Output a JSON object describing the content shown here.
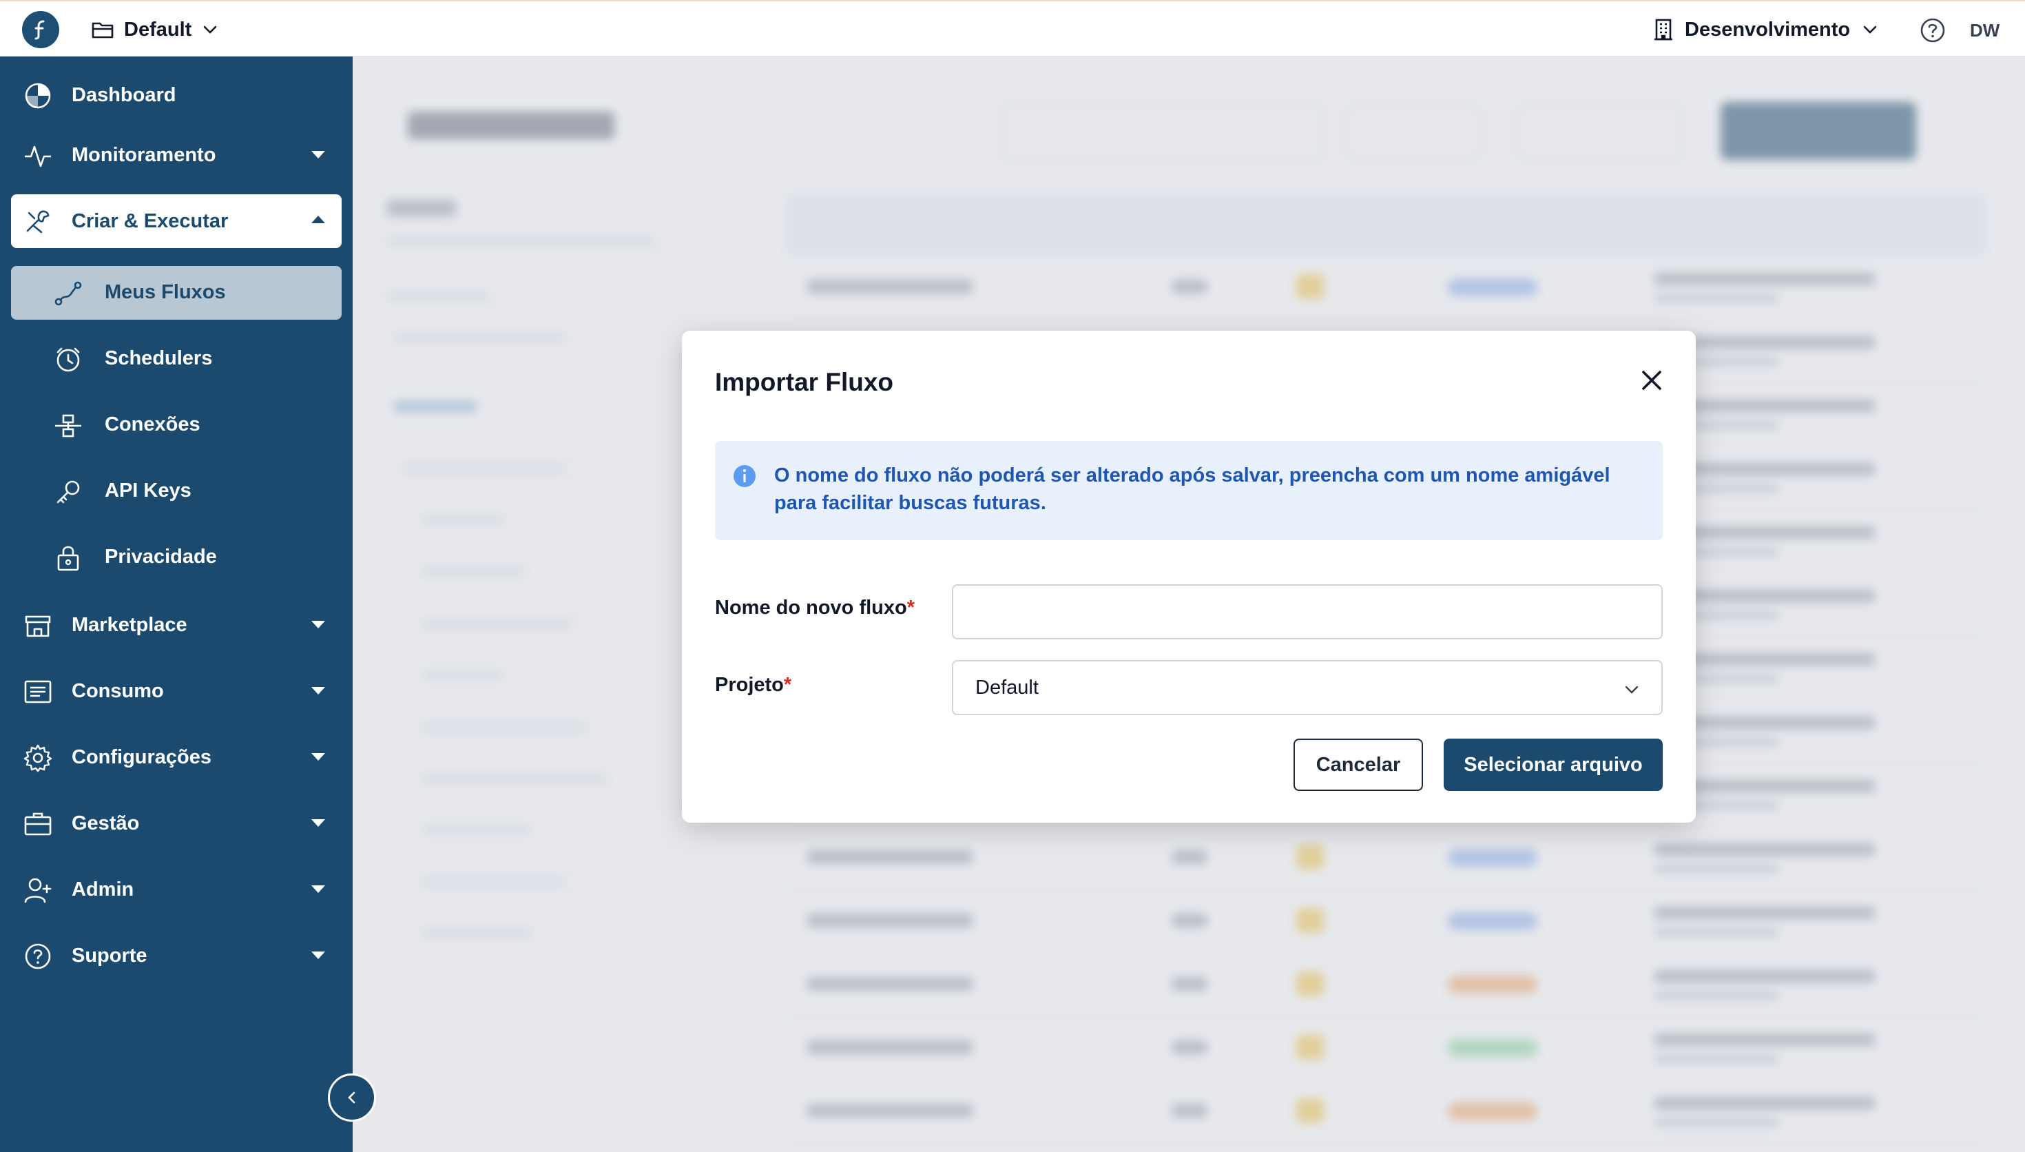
{
  "topbar": {
    "project_name": "Default",
    "org_name": "Desenvolvimento",
    "avatar_initials": "DW"
  },
  "sidebar": {
    "items": [
      {
        "label": "Dashboard",
        "icon": "dashboard-icon"
      },
      {
        "label": "Monitoramento",
        "icon": "activity-icon"
      },
      {
        "label": "Criar & Executar",
        "icon": "tools-icon"
      },
      {
        "label": "Marketplace",
        "icon": "store-icon"
      },
      {
        "label": "Consumo",
        "icon": "receipt-icon"
      },
      {
        "label": "Configurações",
        "icon": "gear-icon"
      },
      {
        "label": "Gestão",
        "icon": "briefcase-icon"
      },
      {
        "label": "Admin",
        "icon": "user-plus-icon"
      },
      {
        "label": "Suporte",
        "icon": "help-icon"
      }
    ],
    "sub_items": [
      {
        "label": "Meus Fluxos",
        "icon": "flow-icon"
      },
      {
        "label": "Schedulers",
        "icon": "clock-icon"
      },
      {
        "label": "Conexões",
        "icon": "connection-icon"
      },
      {
        "label": "API Keys",
        "icon": "key-icon"
      },
      {
        "label": "Privacidade",
        "icon": "lock-icon"
      }
    ]
  },
  "modal": {
    "title": "Importar Fluxo",
    "alert_text": "O nome do fluxo não poderá ser alterado após salvar, preencha com um nome amigável para facilitar buscas futuras.",
    "name_label": "Nome do novo fluxo",
    "name_value": "",
    "project_label": "Projeto",
    "project_value": "Default",
    "required_mark": "*",
    "cancel_label": "Cancelar",
    "submit_label": "Selecionar arquivo"
  },
  "colors": {
    "brand": "#1b4a6e",
    "alert_bg": "#e8f1fb",
    "alert_text": "#1e56b0",
    "required": "#d92d20"
  }
}
